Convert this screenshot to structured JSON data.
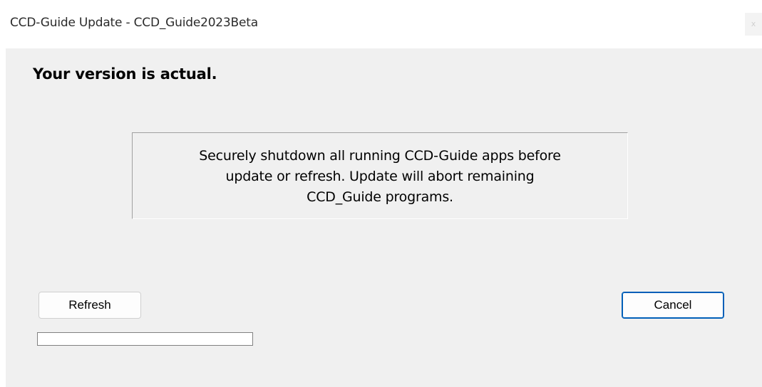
{
  "window": {
    "title": "CCD-Guide Update - CCD_Guide2023Beta",
    "close_label": "x"
  },
  "main": {
    "headline": "Your version is actual.",
    "info_line1": "Securely shutdown all running CCD-Guide apps before",
    "info_line2": "update or refresh. Update will abort remaining",
    "info_line3": "CCD_Guide programs."
  },
  "buttons": {
    "refresh_label": "Refresh",
    "cancel_label": "Cancel"
  },
  "progress": {
    "value_percent": 0,
    "fill_color": "#06b025"
  },
  "colors": {
    "client_background": "#f0f0f0",
    "default_button_border": "#005fb8"
  }
}
